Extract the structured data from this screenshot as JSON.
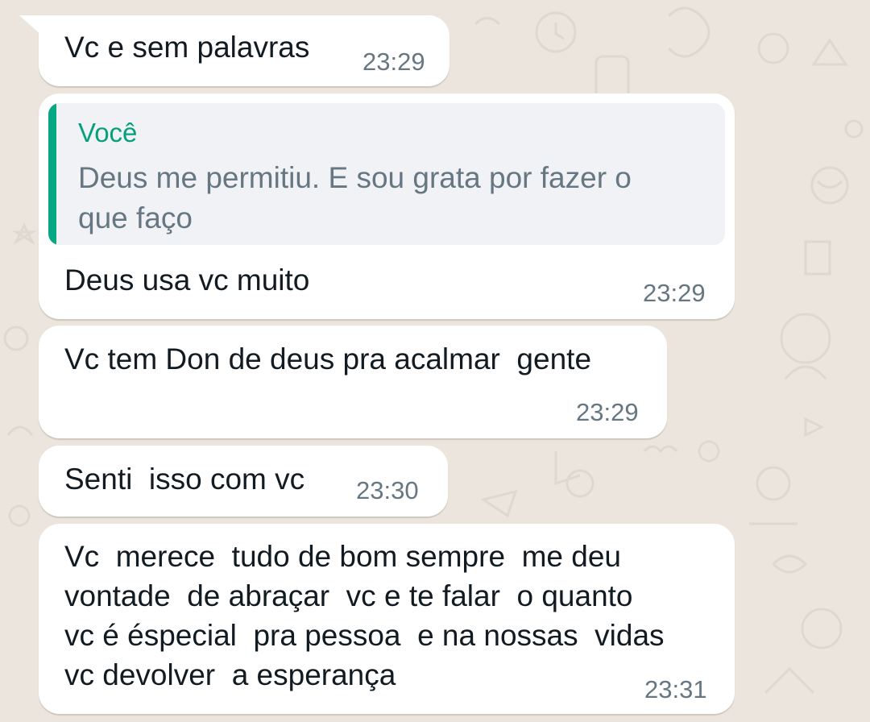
{
  "chat": {
    "messages": [
      {
        "text": "Vc e sem palavras",
        "time": "23:29"
      },
      {
        "quote": {
          "author": "Você",
          "text": "Deus me permitiu. E sou grata por fazer o\nque faço"
        },
        "text": "Deus usa vc muito",
        "time": "23:29"
      },
      {
        "text": "Vc tem Don de deus pra acalmar  gente",
        "time": "23:29"
      },
      {
        "text": "Senti  isso com vc",
        "time": "23:30"
      },
      {
        "text": "Vc  merece  tudo de bom sempre  me deu\nvontade  de abraçar  vc e te falar  o quanto\nvc é éspecial  pra pessoa  e na nossas  vidas\nvc devolver  a esperança",
        "time": "23:31"
      }
    ]
  },
  "colors": {
    "background": "#ECE5DD",
    "bubble": "#FFFFFF",
    "quote_accent": "#06A884",
    "quote_author": "#07A07C",
    "timestamp": "#667781"
  }
}
